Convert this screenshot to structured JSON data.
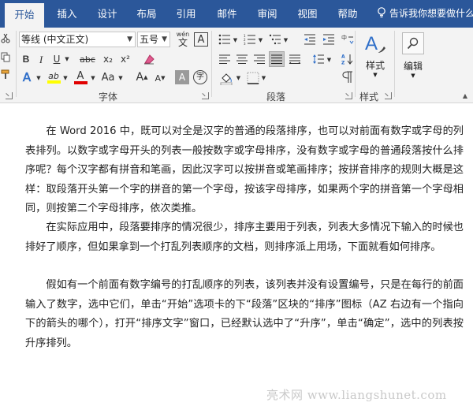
{
  "tabs": [
    {
      "label": "开始",
      "active": true
    },
    {
      "label": "插入"
    },
    {
      "label": "设计"
    },
    {
      "label": "布局"
    },
    {
      "label": "引用"
    },
    {
      "label": "邮件"
    },
    {
      "label": "审阅"
    },
    {
      "label": "视图"
    },
    {
      "label": "帮助"
    }
  ],
  "tell_me": "告诉我你想要做什么",
  "font": {
    "name": "等线 (中文正文)",
    "size": "五号",
    "group_label": "字体",
    "bold": "B",
    "italic": "I",
    "underline": "U",
    "strikethrough": "abc",
    "subscript": "x₂",
    "superscript": "x²",
    "text_effects": "A",
    "highlight": "ab",
    "font_color": "A",
    "change_case": "Aa",
    "grow": "A",
    "shrink": "A",
    "char_shading": "A",
    "enclose": "字",
    "phonetic": "wén",
    "phonetic_char": "文",
    "char_border": "A"
  },
  "paragraph": {
    "group_label": "段落"
  },
  "styles": {
    "button_label": "样式",
    "group_label": "样式"
  },
  "editing": {
    "button_label": "编辑"
  },
  "colors": {
    "accent": "#2b579a",
    "highlight": "#ffff00",
    "font_color": "#e00000"
  },
  "document": {
    "paragraphs": [
      "在 Word 2016 中，既可以对全是汉字的普通的段落排序，也可以对前面有数字或字母的列表排列。以数字或字母开头的列表一般按数字或字母排序，没有数字或字母的普通段落按什么排序呢？每个汉字都有拼音和笔画，因此汉字可以按拼音或笔画排序；按拼音排序的规则大概是这样：取段落开头第一个字的拼音的第一个字母，按该字母排序，如果两个字的拼音第一个字母相同，则按第二个字母排序，依次类推。",
      "在实际应用中，段落要排序的情况很少，排序主要用于列表，列表大多情况下输入的时候也排好了顺序，但如果拿到一个打乱列表顺序的文档，则排序派上用场，下面就看如何排序。",
      "假如有一个前面有数字编号的打乱顺序的列表，该列表并没有设置编号，只是在每行的前面输入了数字，选中它们，单击“开始”选项卡的下“段落”区块的“排序”图标（AZ 右边有一个指向下的箭头的哪个），打开“排序文字”窗口，已经默认选中了“升序”，单击“确定”，选中的列表按升序排列。"
    ]
  },
  "watermark": "亮术网 www.liangshunet.com"
}
